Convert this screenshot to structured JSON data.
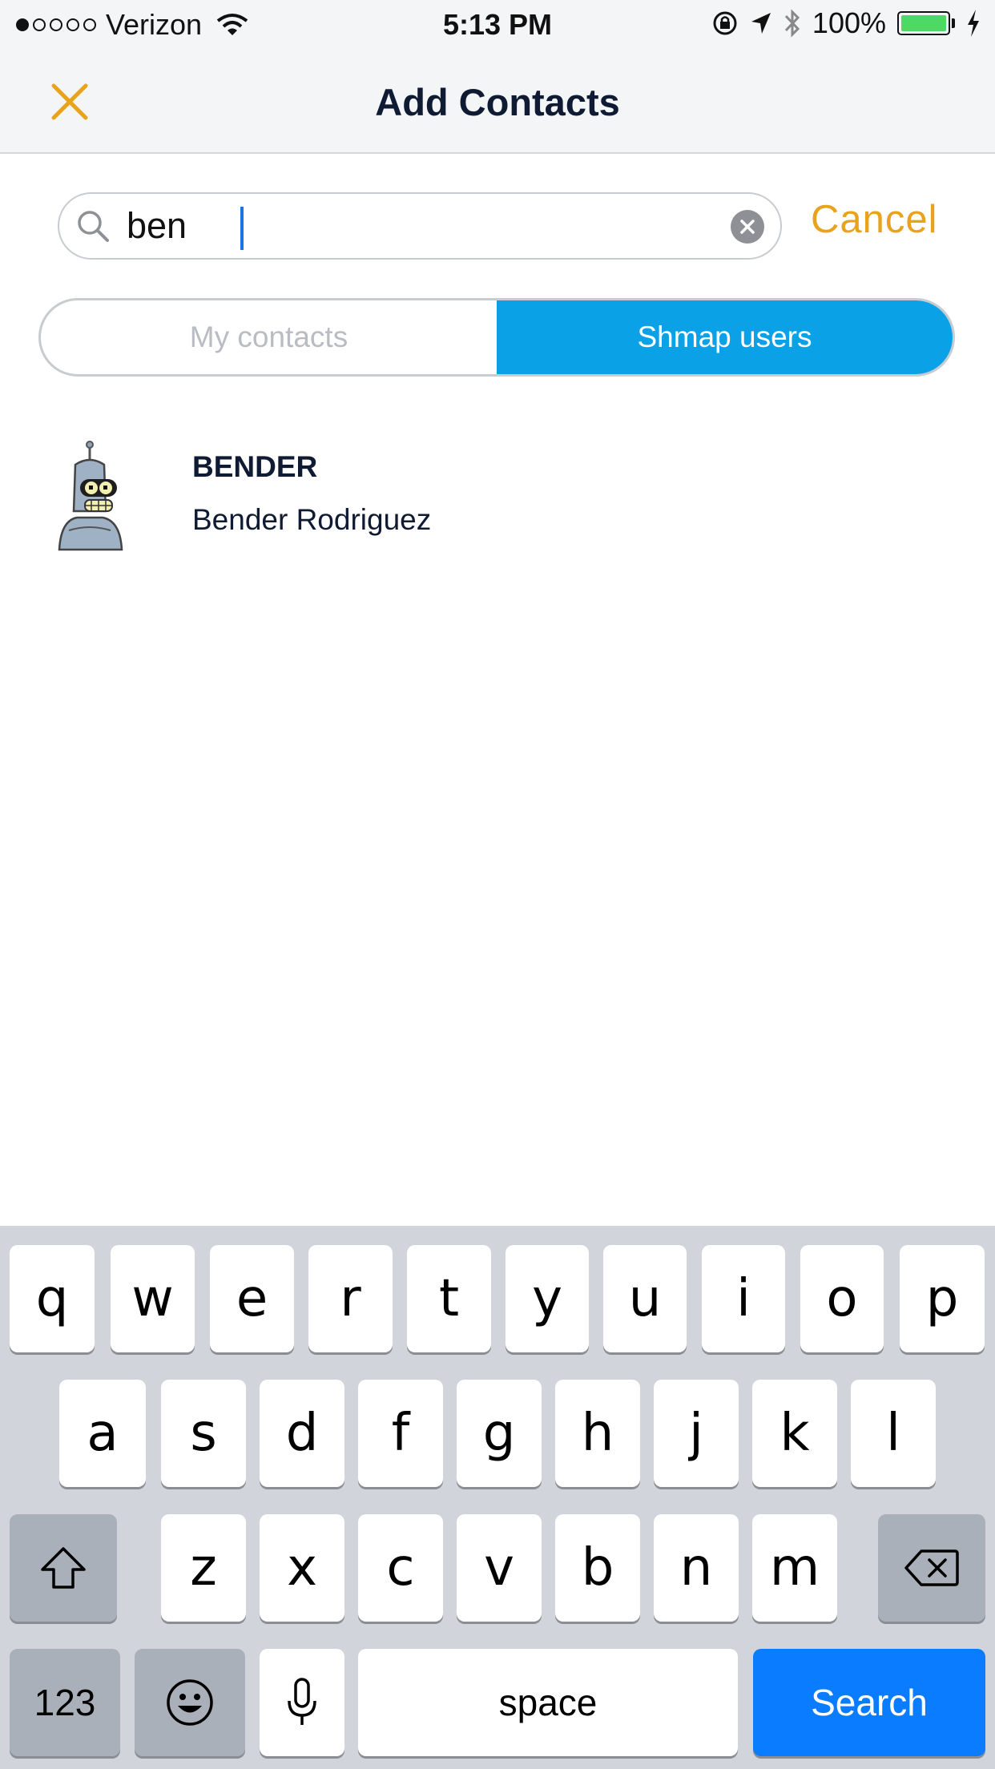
{
  "status_bar": {
    "carrier": "Verizon",
    "time": "5:13 PM",
    "battery": "100%"
  },
  "nav": {
    "title": "Add Contacts",
    "close_icon": "close-x-icon"
  },
  "search": {
    "value": "ben",
    "cancel_label": "Cancel"
  },
  "segments": {
    "my_contacts": "My contacts",
    "shmap_users": "Shmap users",
    "selected": "Shmap users"
  },
  "results": [
    {
      "username": "BENDER",
      "full_name": "Bender Rodriguez",
      "avatar": "bender-robot-avatar"
    }
  ],
  "keyboard": {
    "row1": [
      "q",
      "w",
      "e",
      "r",
      "t",
      "y",
      "u",
      "i",
      "o",
      "p"
    ],
    "row2": [
      "a",
      "s",
      "d",
      "f",
      "g",
      "h",
      "j",
      "k",
      "l"
    ],
    "row3": [
      "z",
      "x",
      "c",
      "v",
      "b",
      "n",
      "m"
    ],
    "numbers_label": "123",
    "space_label": "space",
    "search_label": "Search"
  },
  "colors": {
    "accent_orange": "#e8a21c",
    "segment_active": "#0aa1e6",
    "keyboard_search": "#0a7cff",
    "battery_green": "#4cd964"
  }
}
